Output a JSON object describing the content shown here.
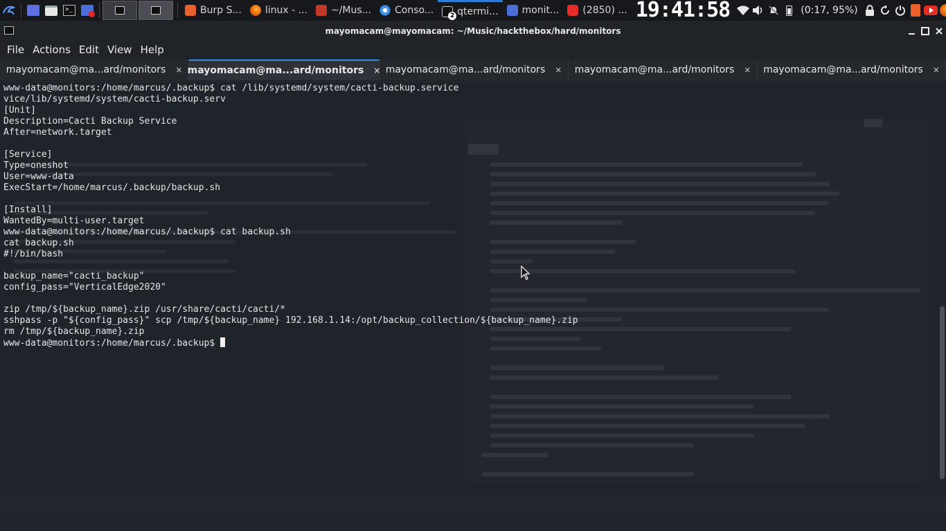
{
  "taskbar": {
    "tasks": [
      {
        "label": "Burp S...",
        "icon": "burp-icon",
        "color": "#e8602c"
      },
      {
        "label": "linux - ...",
        "icon": "firefox-icon",
        "color": "#e66000"
      },
      {
        "label": "~/Mus...",
        "icon": "folder-icon",
        "color": "#c0392b"
      },
      {
        "label": "Conso...",
        "icon": "chromium-icon",
        "color": "#4a90e2"
      },
      {
        "label": "qtermi...",
        "icon": "terminal-icon",
        "color": "#2e2e2e",
        "badge": "2"
      },
      {
        "label": "monit...",
        "icon": "folder-icon",
        "color": "#4a6fd8"
      },
      {
        "label": "(2850) ...",
        "icon": "youtube-icon",
        "color": "#e52d27"
      }
    ],
    "clock": "19:41:58",
    "battery": "(0:17, 95%)"
  },
  "window": {
    "title": "mayomacam@mayomacam: ~/Music/hackthebox/hard/monitors"
  },
  "menu": [
    "File",
    "Actions",
    "Edit",
    "View",
    "Help"
  ],
  "tabs": [
    {
      "label": "mayomacam@ma...ard/monitors",
      "active": false
    },
    {
      "label": "mayomacam@ma...ard/monitors",
      "active": true
    },
    {
      "label": "mayomacam@ma...ard/monitors",
      "active": false
    },
    {
      "label": "mayomacam@ma...ard/monitors",
      "active": false
    },
    {
      "label": "mayomacam@ma...ard/monitors",
      "active": false
    }
  ],
  "tab_close_glyph": "×",
  "terminal": {
    "lines": [
      "www-data@monitors:/home/marcus/.backup$ cat /lib/systemd/system/cacti-backup.service",
      "vice/lib/systemd/system/cacti-backup.serv",
      "[Unit]",
      "Description=Cacti Backup Service",
      "After=network.target",
      "",
      "[Service]",
      "Type=oneshot",
      "User=www-data",
      "ExecStart=/home/marcus/.backup/backup.sh",
      "",
      "[Install]",
      "WantedBy=multi-user.target",
      "www-data@monitors:/home/marcus/.backup$ cat backup.sh",
      "cat backup.sh",
      "#!/bin/bash",
      "",
      "backup_name=\"cacti_backup\"",
      "config_pass=\"VerticalEdge2020\"",
      "",
      "zip /tmp/${backup_name}.zip /usr/share/cacti/cacti/*",
      "sshpass -p \"${config_pass}\" scp /tmp/${backup_name} 192.168.1.14:/opt/backup_collection/${backup_name}.zip",
      "rm /tmp/${backup_name}.zip"
    ],
    "prompt": "www-data@monitors:/home/marcus/.backup$ "
  }
}
